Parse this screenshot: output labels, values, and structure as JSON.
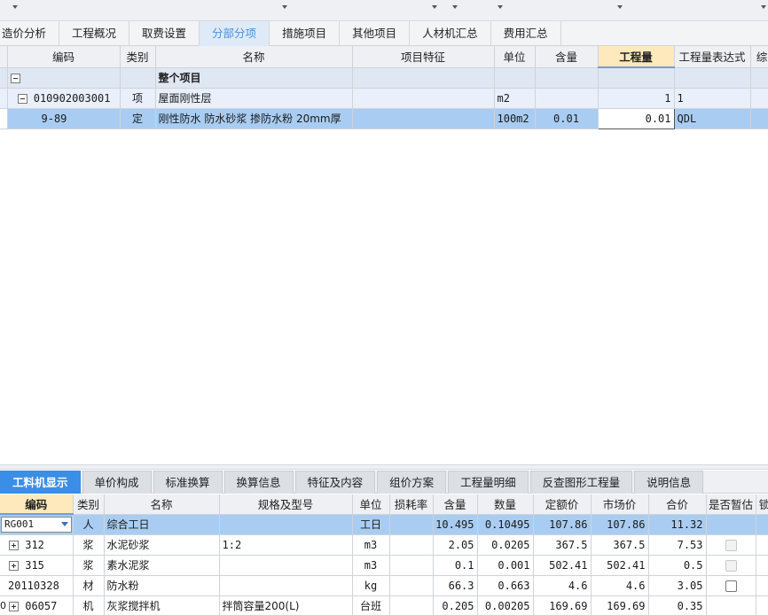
{
  "main_tabs": [
    "造价分析",
    "工程概况",
    "取费设置",
    "分部分项",
    "措施项目",
    "其他项目",
    "人材机汇总",
    "费用汇总"
  ],
  "active_main_tab": 3,
  "top_table": {
    "headers": [
      "编码",
      "类别",
      "名称",
      "项目特征",
      "单位",
      "含量",
      "工程量",
      "工程量表达式",
      "综"
    ],
    "rows": [
      {
        "code": "",
        "type": "",
        "name": "整个项目",
        "feature": "",
        "unit": "",
        "content": "",
        "qty": "",
        "expr": ""
      },
      {
        "code": "010902003001",
        "type": "项",
        "name": "屋面刚性层",
        "feature": "",
        "unit": "m2",
        "content": "",
        "qty": "1",
        "expr": "1"
      },
      {
        "code": "9-89",
        "type": "定",
        "name": "刚性防水 防水砂浆 掺防水粉 20mm厚",
        "feature": "",
        "unit": "100m2",
        "content": "0.01",
        "qty": "0.01",
        "expr": "QDL"
      }
    ]
  },
  "bottom_tabs": [
    "工料机显示",
    "单价构成",
    "标准换算",
    "换算信息",
    "特征及内容",
    "组价方案",
    "工程量明细",
    "反查图形工程量",
    "说明信息"
  ],
  "active_bottom_tab": 0,
  "bottom_table": {
    "headers": [
      "编码",
      "类别",
      "名称",
      "规格及型号",
      "单位",
      "损耗率",
      "含量",
      "数量",
      "定额价",
      "市场价",
      "合价",
      "是否暂估",
      "锁"
    ],
    "rows": [
      {
        "code": "RG001",
        "type": "人",
        "name": "综合工日",
        "spec": "",
        "unit": "工日",
        "loss": "",
        "content": "10.495",
        "amount": "0.10495",
        "quota_price": "107.86",
        "market_price": "107.86",
        "total": "11.32"
      },
      {
        "code": "312",
        "type": "浆",
        "name": "水泥砂浆",
        "spec": "1:2",
        "unit": "m3",
        "loss": "",
        "content": "2.05",
        "amount": "0.0205",
        "quota_price": "367.5",
        "market_price": "367.5",
        "total": "7.53"
      },
      {
        "code": "315",
        "type": "浆",
        "name": "素水泥浆",
        "spec": "",
        "unit": "m3",
        "loss": "",
        "content": "0.1",
        "amount": "0.001",
        "quota_price": "502.41",
        "market_price": "502.41",
        "total": "0.5"
      },
      {
        "code": "20110328",
        "type": "材",
        "name": "防水粉",
        "spec": "",
        "unit": "kg",
        "loss": "",
        "content": "66.3",
        "amount": "0.663",
        "quota_price": "4.6",
        "market_price": "4.6",
        "total": "3.05"
      },
      {
        "code": "06057",
        "type": "机",
        "name": "灰浆搅拌机",
        "spec": "拌筒容量200(L)",
        "unit": "台班",
        "loss": "",
        "content": "0.205",
        "amount": "0.00205",
        "quota_price": "169.69",
        "market_price": "169.69",
        "total": "0.35"
      }
    ],
    "left_edge_marker": "0"
  }
}
